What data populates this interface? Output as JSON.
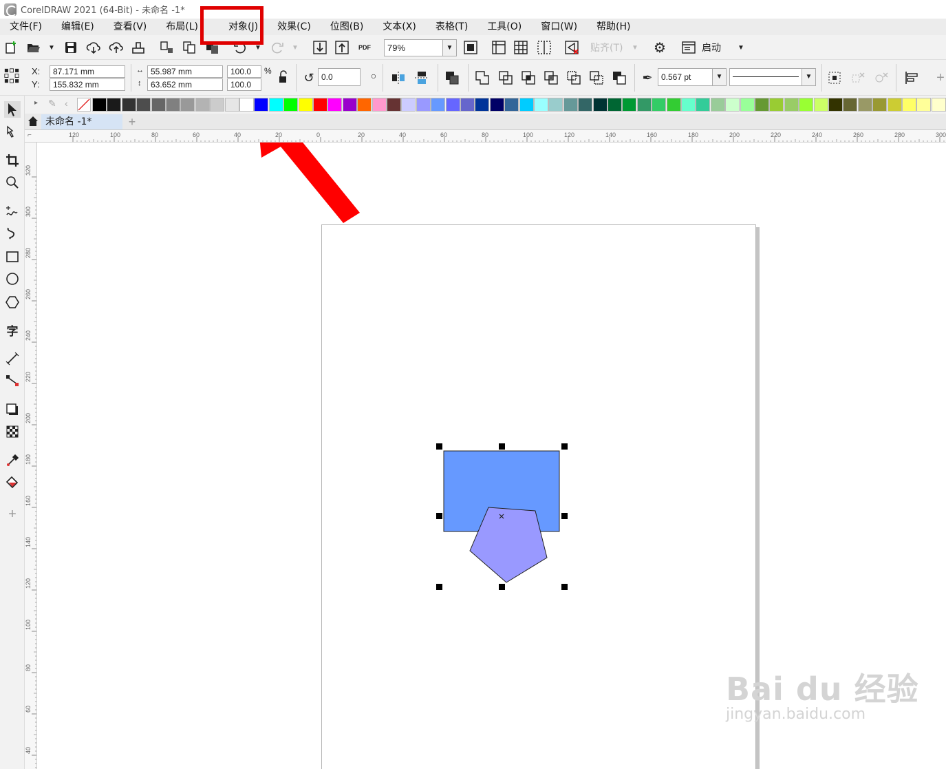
{
  "window": {
    "title": "CorelDRAW 2021 (64-Bit) - 未命名 -1*"
  },
  "menu": [
    "文件(F)",
    "编辑(E)",
    "查看(V)",
    "布局(L)",
    "对象(J)",
    "效果(C)",
    "位图(B)",
    "文本(X)",
    "表格(T)",
    "工具(O)",
    "窗口(W)",
    "帮助(H)"
  ],
  "toolbar": {
    "zoom": "79%",
    "snap_label": "贴齐(T)",
    "launch_label": "启动",
    "pdf_label": "PDF"
  },
  "properties": {
    "x_label": "X:",
    "y_label": "Y:",
    "x": "87.171 mm",
    "y": "155.832 mm",
    "width": "55.987 mm",
    "height": "63.652 mm",
    "scale_x": "100.0",
    "scale_y": "100.0",
    "percent": "%",
    "rotation": "0.0",
    "outline_width": "0.567 pt"
  },
  "document": {
    "tab_label": "未命名 -1*"
  },
  "rulers": {
    "h_ticks": [
      "120",
      "100",
      "80",
      "60",
      "40",
      "20",
      "0",
      "20",
      "40",
      "60",
      "80",
      "100",
      "120",
      "140",
      "160",
      "180",
      "200",
      "220",
      "240",
      "260",
      "280",
      "300"
    ],
    "v_ticks": [
      "320",
      "300",
      "280",
      "260",
      "240",
      "220",
      "200",
      "180",
      "160",
      "140",
      "120",
      "100",
      "80",
      "60",
      "40"
    ]
  },
  "palette_colors": [
    "#000000",
    "#1a1a1a",
    "#333333",
    "#4d4d4d",
    "#666666",
    "#808080",
    "#999999",
    "#b3b3b3",
    "#cccccc",
    "#e6e6e6",
    "#ffffff",
    "#0000ff",
    "#00ffff",
    "#00ff00",
    "#ffff00",
    "#ff0000",
    "#ff00ff",
    "#9900cc",
    "#ff6600",
    "#ff99cc",
    "#663333",
    "#ccccff",
    "#9999ff",
    "#6699ff",
    "#6666ff",
    "#6666cc",
    "#003399",
    "#000066",
    "#336699",
    "#00ccff",
    "#99ffff",
    "#99cccc",
    "#669999",
    "#336666",
    "#003333",
    "#006633",
    "#009933",
    "#339966",
    "#33cc66",
    "#33cc33",
    "#66ffcc",
    "#33cc99",
    "#99cc99",
    "#ccffcc",
    "#99ff99",
    "#669933",
    "#99cc33",
    "#99cc66",
    "#99ff33",
    "#ccff66",
    "#333300",
    "#666633",
    "#999966",
    "#999933",
    "#cccc33",
    "#ffff66",
    "#ffff99",
    "#ffffcc"
  ],
  "colors": {
    "rect_fill": "#6699ff",
    "pentagon_fill": "#9999ff",
    "highlight": "#e00000",
    "arrow": "#ff0000"
  },
  "watermark": {
    "main": "Bai du 经验",
    "sub": "jingyan.baidu.com"
  }
}
